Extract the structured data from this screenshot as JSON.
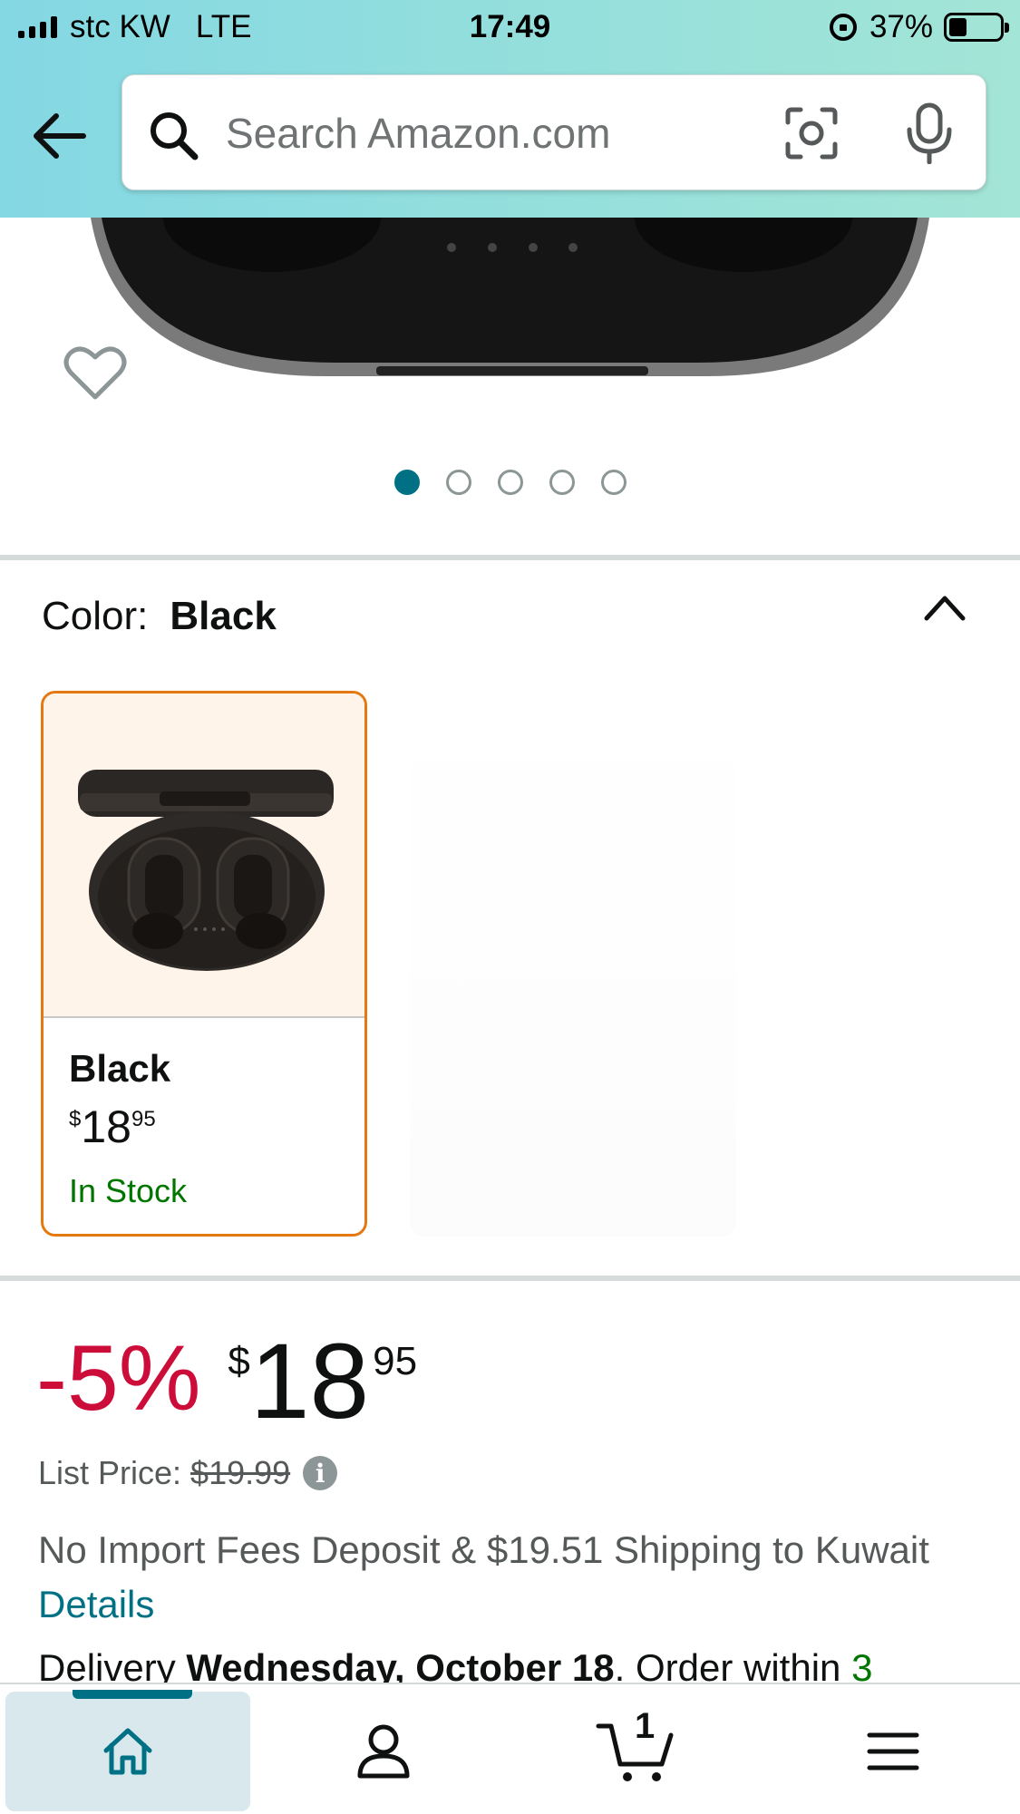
{
  "status_bar": {
    "carrier": "stc KW",
    "network": "LTE",
    "time": "17:49",
    "battery": "37%"
  },
  "search": {
    "placeholder": "Search Amazon.com"
  },
  "carousel": {
    "total": 5,
    "active": 1
  },
  "color": {
    "label": "Color:",
    "value": "Black"
  },
  "swatches": [
    {
      "name": "Black",
      "currency": "$",
      "price_whole": "18",
      "price_fraction": "95",
      "availability": "In Stock"
    }
  ],
  "pricing": {
    "discount": "-5%",
    "currency": "$",
    "price_whole": "18",
    "price_fraction": "95",
    "list_price_label": "List Price:",
    "list_price": "$19.99"
  },
  "shipping": {
    "text": "No Import Fees Deposit & $19.51 Shipping to Kuwait",
    "details_link": "Details"
  },
  "delivery": {
    "prefix": "Delivery",
    "date": "Wednesday, October 18",
    "suffix": ". Order within",
    "time_left": "3"
  },
  "bottom_nav": {
    "cart_count": "1",
    "items": [
      "home",
      "account",
      "cart",
      "menu"
    ]
  },
  "colors": {
    "accent": "#007185",
    "discount": "#cc0c39",
    "in_stock": "#007600",
    "selected_border": "#e47911",
    "header": "#84d8e3"
  }
}
